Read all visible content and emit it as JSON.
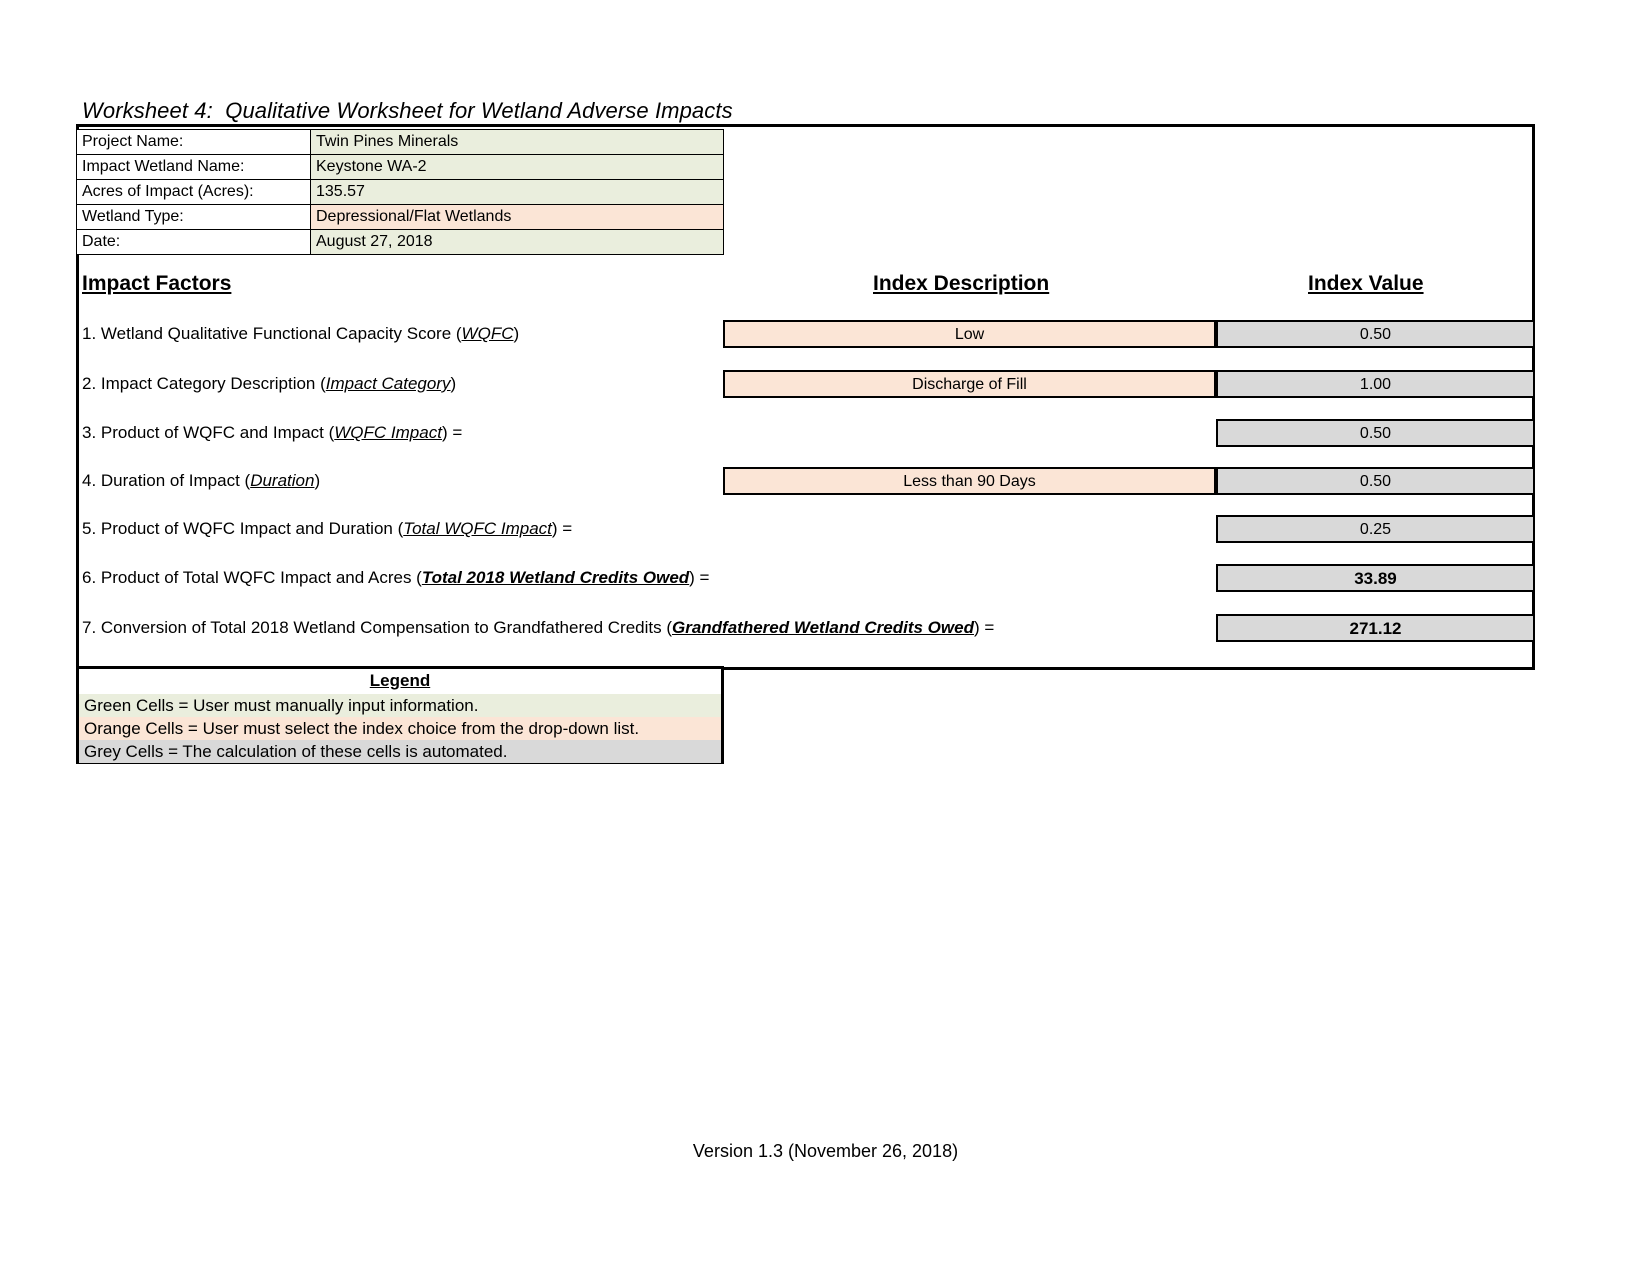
{
  "title": "Worksheet 4:  Qualitative Worksheet for Wetland Adverse Impacts",
  "info": {
    "rows": [
      {
        "label": "Project Name:",
        "value": "Twin Pines Minerals",
        "fill": "green"
      },
      {
        "label": "Impact Wetland Name:",
        "value": "Keystone WA-2",
        "fill": "green"
      },
      {
        "label": "Acres of Impact (Acres):",
        "value": "135.57",
        "fill": "green"
      },
      {
        "label": "Wetland Type:",
        "value": "Depressional/Flat Wetlands",
        "fill": "orange"
      },
      {
        "label": "Date:",
        "value": "August 27, 2018",
        "fill": "green"
      }
    ]
  },
  "headers": {
    "impact_factors": "Impact Factors",
    "index_description": "Index Description",
    "index_value": "Index Value"
  },
  "factors": [
    {
      "num": "1. ",
      "text_before": "Wetland Qualitative Functional Capacity Score (",
      "term": "WQFC",
      "term_style": "italic",
      "text_after": ")",
      "description": "Low",
      "value": "0.50",
      "value_bold": false,
      "has_description": true
    },
    {
      "num": "2. ",
      "text_before": "Impact Category Description (",
      "term": "Impact Category",
      "term_style": "italic",
      "text_after": ")",
      "description": "Discharge of Fill",
      "value": "1.00",
      "value_bold": false,
      "has_description": true
    },
    {
      "num": "3. ",
      "text_before": "Product of WQFC and Impact (",
      "term": "WQFC Impact",
      "term_style": "italic",
      "text_after": ") =",
      "description": "",
      "value": "0.50",
      "value_bold": false,
      "has_description": false
    },
    {
      "num": "4. ",
      "text_before": "Duration of Impact (",
      "term": "Duration",
      "term_style": "italic",
      "text_after": ")",
      "description": "Less than 90 Days",
      "value": "0.50",
      "value_bold": false,
      "has_description": true
    },
    {
      "num": "5. ",
      "text_before": "Product of WQFC Impact and Duration (",
      "term": "Total WQFC Impact",
      "term_style": "italic",
      "text_after": ") =",
      "description": "",
      "value": "0.25",
      "value_bold": false,
      "has_description": false
    },
    {
      "num": "6. ",
      "text_before": "Product of Total WQFC Impact and Acres (",
      "term": "Total 2018 Wetland Credits Owed",
      "term_style": "bold-italic",
      "text_after": ") =",
      "description": "",
      "value": "33.89",
      "value_bold": true,
      "has_description": false
    },
    {
      "num": "7. ",
      "text_before": "Conversion of Total 2018 Wetland Compensation to Grandfathered Credits (",
      "term": "Grandfathered Wetland Credits Owed",
      "term_style": "bold-italic",
      "text_after": ") =",
      "description": "",
      "value": "271.12",
      "value_bold": true,
      "has_description": false
    }
  ],
  "legend": {
    "title": "Legend",
    "green": "Green Cells = User must manually input information.",
    "orange": "Orange Cells = User must select the index choice from the drop-down list.",
    "grey": "Grey Cells = The calculation of these cells is automated."
  },
  "footer": {
    "version": "Version 1.3 (November 26, 2018)"
  },
  "colors": {
    "green_fill": "#eaeedd",
    "orange_fill": "#fbe5d6",
    "grey_fill": "#d9d9d9",
    "border": "#000000"
  }
}
